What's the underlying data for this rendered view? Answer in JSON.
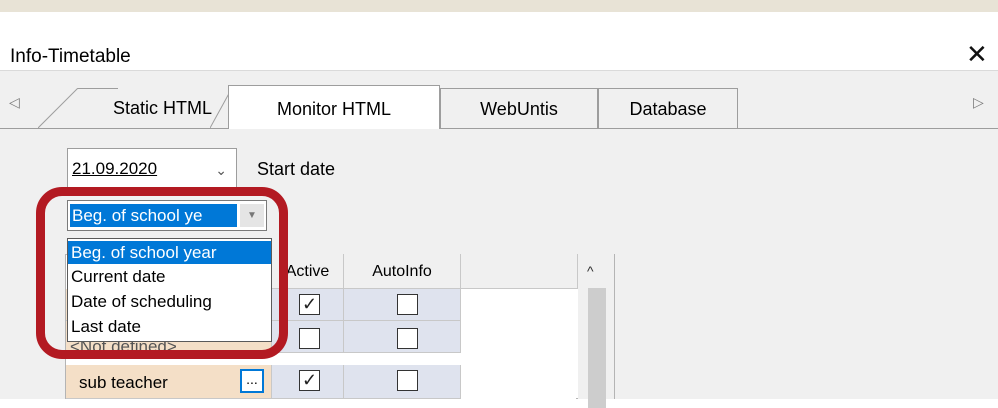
{
  "window": {
    "title": "Info-Timetable",
    "close_glyph": "✕"
  },
  "tabs": {
    "scroll_left": "◁",
    "scroll_right": "▷",
    "items": [
      {
        "label": "Static HTML",
        "active": false
      },
      {
        "label": "Monitor HTML",
        "active": true
      },
      {
        "label": "WebUntis",
        "active": false
      },
      {
        "label": "Database",
        "active": false
      }
    ]
  },
  "date_picker": {
    "value": "21.09.2020",
    "chevron": "⌄",
    "label": "Start date"
  },
  "start_mode_combo": {
    "selected": "Beg. of school ye",
    "arrow": "▼",
    "options": [
      "Beg. of school year",
      "Current date",
      "Date of scheduling",
      "Last date"
    ]
  },
  "grid": {
    "columns": [
      "Active",
      "AutoInfo"
    ],
    "partial_row_text": "<Not defined>",
    "rows": [
      {
        "name": "",
        "active": true,
        "autoinfo": false
      },
      {
        "name": "",
        "active": false,
        "autoinfo": false
      },
      {
        "name": "sub teacher",
        "active": true,
        "autoinfo": false
      }
    ],
    "ellipsis_label": "...",
    "scroll_up": "^"
  },
  "colors": {
    "accent": "#0078d7",
    "annotation_red": "#b31a22",
    "name_cell": "#f4dfc7",
    "check_cell": "#dfe3ee"
  },
  "icons": {
    "close": "close-icon",
    "checkmark": "checkmark-icon",
    "dropdown": "chevron-down-icon"
  }
}
